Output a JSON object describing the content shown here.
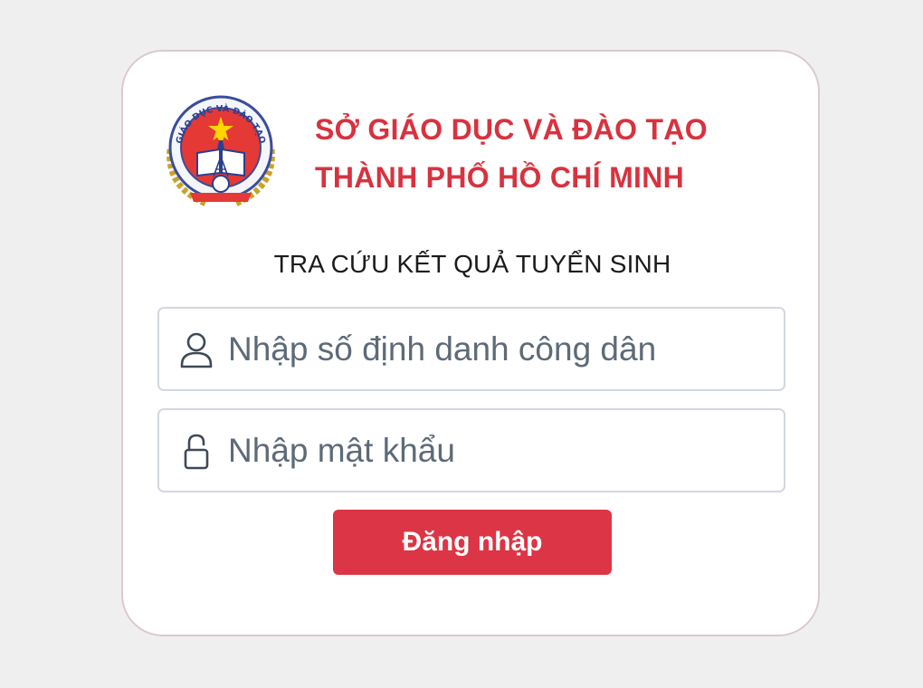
{
  "header": {
    "org_line1": "SỞ GIÁO DỤC VÀ ĐÀO TẠO",
    "org_line2": "THÀNH PHỐ HỒ CHÍ MINH",
    "logo_icon": "education-department-emblem-icon",
    "logo_ring_text": "GIÁO DỤC VÀ ĐÀO TẠO"
  },
  "page_title": "TRA CỨU KẾT QUẢ TUYỂN SINH",
  "form": {
    "citizen_id": {
      "value": "",
      "placeholder": "Nhập số định danh công dân",
      "icon": "user-icon"
    },
    "password": {
      "value": "",
      "placeholder": "Nhập mật khẩu",
      "icon": "unlock-icon"
    },
    "login_label": "Đăng nhập"
  },
  "colors": {
    "accent": "#dc3545",
    "title_red": "#d8323f",
    "background": "#efefef",
    "card_border": "#dcc9cf",
    "input_border": "#d2d8df"
  }
}
